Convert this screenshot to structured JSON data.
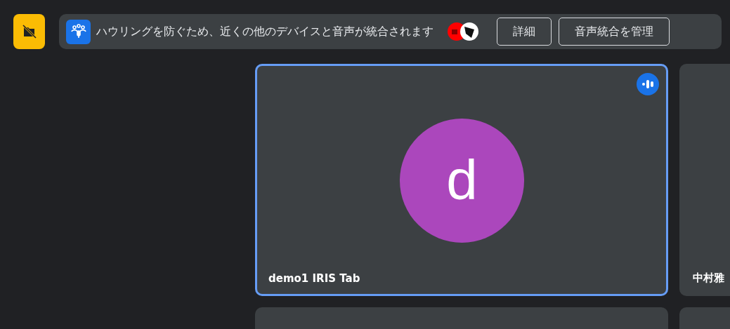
{
  "banner": {
    "message": "ハウリングを防ぐため、近くの他のデバイスと音声が統合されます",
    "buttons": [
      "詳細",
      "音声統合を管理"
    ]
  },
  "tiles": [
    {
      "name": "demo1 IRIS Tab",
      "initial": "d",
      "color": "#ab47bc",
      "selected": true,
      "speaking": true
    },
    {
      "name": "中村雅",
      "selected": false,
      "speaking": false
    },
    {
      "selected": false,
      "speaking": false
    },
    {
      "selected": false,
      "speaking": false
    }
  ]
}
